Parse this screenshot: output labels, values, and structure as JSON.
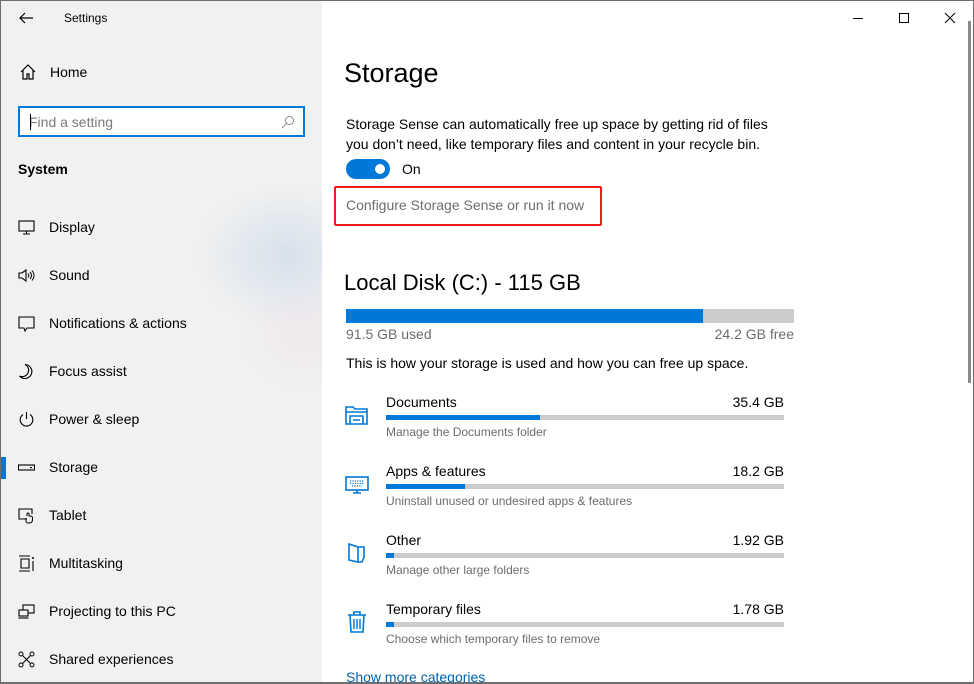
{
  "window": {
    "title": "Settings",
    "controls": {
      "minimize": "minimize",
      "maximize": "maximize",
      "close": "close"
    }
  },
  "sidebar": {
    "home_label": "Home",
    "search": {
      "placeholder": "Find a setting",
      "value": ""
    },
    "section": "System",
    "items": [
      {
        "label": "Display",
        "icon": "display-icon",
        "selected": false
      },
      {
        "label": "Sound",
        "icon": "sound-icon",
        "selected": false
      },
      {
        "label": "Notifications & actions",
        "icon": "notifications-icon",
        "selected": false
      },
      {
        "label": "Focus assist",
        "icon": "moon-icon",
        "selected": false
      },
      {
        "label": "Power & sleep",
        "icon": "power-icon",
        "selected": false
      },
      {
        "label": "Storage",
        "icon": "storage-drive-icon",
        "selected": true
      },
      {
        "label": "Tablet",
        "icon": "tablet-icon",
        "selected": false
      },
      {
        "label": "Multitasking",
        "icon": "multitasking-icon",
        "selected": false
      },
      {
        "label": "Projecting to this PC",
        "icon": "projecting-icon",
        "selected": false
      },
      {
        "label": "Shared experiences",
        "icon": "shared-experiences-icon",
        "selected": false
      }
    ]
  },
  "main": {
    "title": "Storage",
    "description": "Storage Sense can automatically free up space by getting rid of files you don’t need, like temporary files and content in your recycle bin.",
    "storage_sense": {
      "state_label": "On",
      "on": true
    },
    "configure_link": "Configure Storage Sense or run it now",
    "disk": {
      "title": "Local Disk (C:) - 115 GB",
      "used_label": "91.5 GB used",
      "free_label": "24.2 GB free",
      "used_fraction": 0.796
    },
    "usage_description": "This is how your storage is used and how you can free up space.",
    "categories": [
      {
        "name": "Documents",
        "size": "35.4 GB",
        "subtitle": "Manage the Documents folder",
        "icon": "documents-folder-icon",
        "fraction": 0.387
      },
      {
        "name": "Apps & features",
        "size": "18.2 GB",
        "subtitle": "Uninstall unused or undesired apps & features",
        "icon": "apps-keyboard-icon",
        "fraction": 0.199
      },
      {
        "name": "Other",
        "size": "1.92 GB",
        "subtitle": "Manage other large folders",
        "icon": "other-folder-icon",
        "fraction": 0.021
      },
      {
        "name": "Temporary files",
        "size": "1.78 GB",
        "subtitle": "Choose which temporary files to remove",
        "icon": "trash-icon",
        "fraction": 0.019
      }
    ],
    "show_more": "Show more categories"
  },
  "colors": {
    "accent": "#0078d7",
    "highlight_box": "#ee1c1c",
    "bar_track": "#cccccc"
  }
}
